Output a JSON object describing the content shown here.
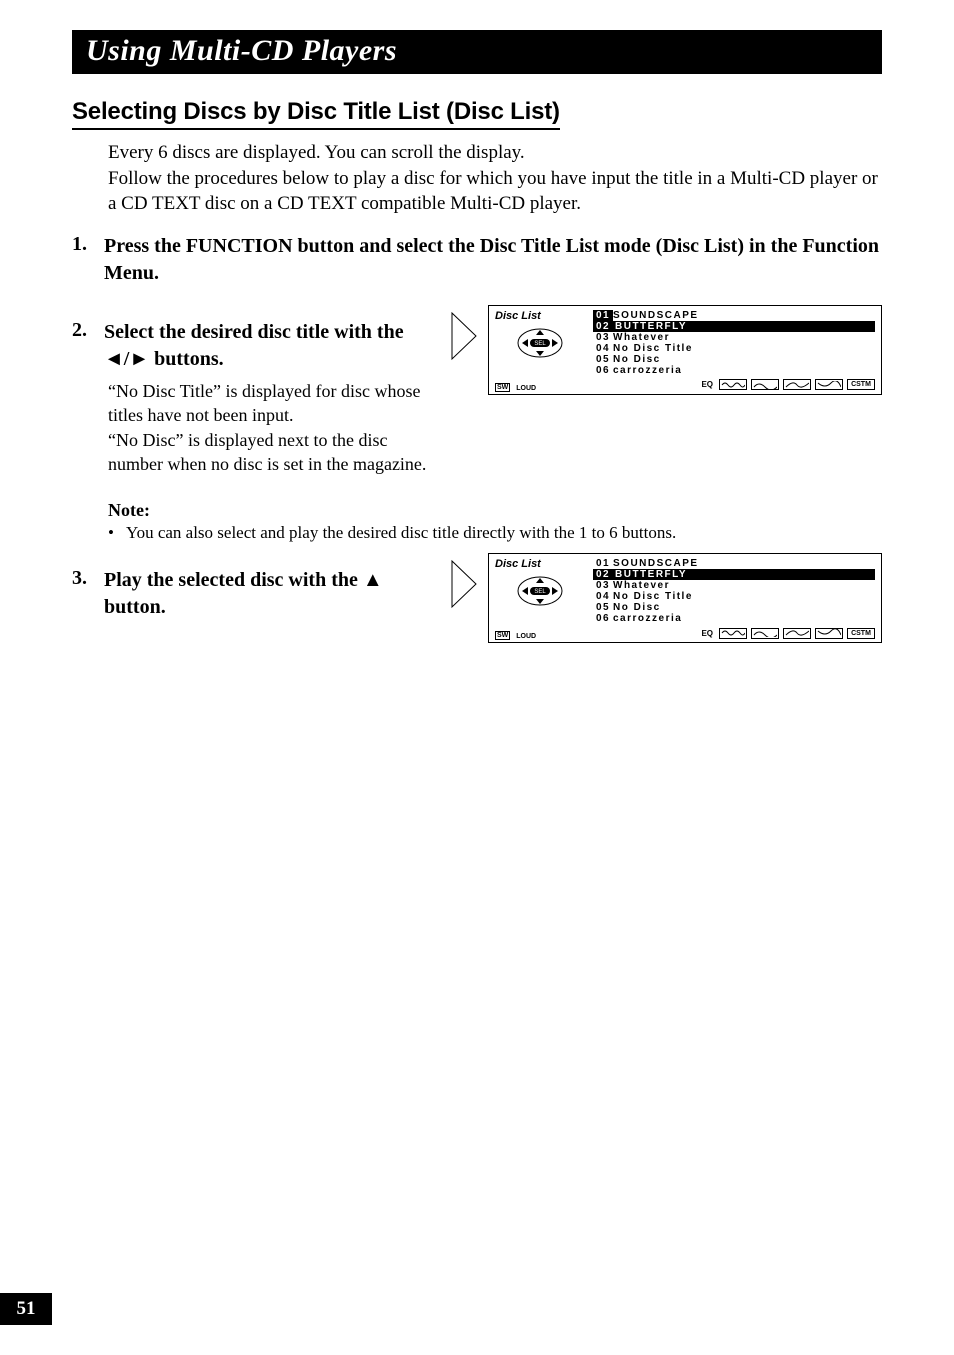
{
  "header": {
    "title": "Using Multi-CD Players"
  },
  "section": {
    "title": "Selecting Discs by Disc Title List (Disc List)"
  },
  "intro": "Every 6 discs are displayed. You can scroll the display.\nFollow the procedures below to play a disc for which you have input the title in a Multi-CD player or a CD TEXT disc on a CD TEXT compatible Multi-CD player.",
  "steps": {
    "s1": {
      "num": "1.",
      "text": "Press the FUNCTION button and select the Disc Title List mode (Disc List) in the Function Menu."
    },
    "s2": {
      "num": "2.",
      "text": "Select the desired disc title with the ◄/► buttons.",
      "sub": "“No Disc Title” is displayed for disc whose titles have not been input.\n“No Disc” is displayed next to the disc number when no disc is set in the magazine."
    },
    "s3": {
      "num": "3.",
      "text": "Play the selected disc with the ▲ button."
    }
  },
  "note": {
    "title": "Note:",
    "item": "You can also select and play the desired disc title directly with the 1 to 6 buttons."
  },
  "lcd": {
    "mode": "Disc List",
    "items": [
      {
        "num": "01",
        "title": "SOUNDSCAPE"
      },
      {
        "num": "02",
        "title": "BUTTERFLY"
      },
      {
        "num": "03",
        "title": "Whatever"
      },
      {
        "num": "04",
        "title": "No Disc Title"
      },
      {
        "num": "05",
        "title": "No Disc"
      },
      {
        "num": "06",
        "title": "carrozzeria"
      }
    ],
    "eq": "EQ",
    "cstm": "CSTM",
    "sw": "SW",
    "loud": "LOUD"
  },
  "page_number": "51"
}
